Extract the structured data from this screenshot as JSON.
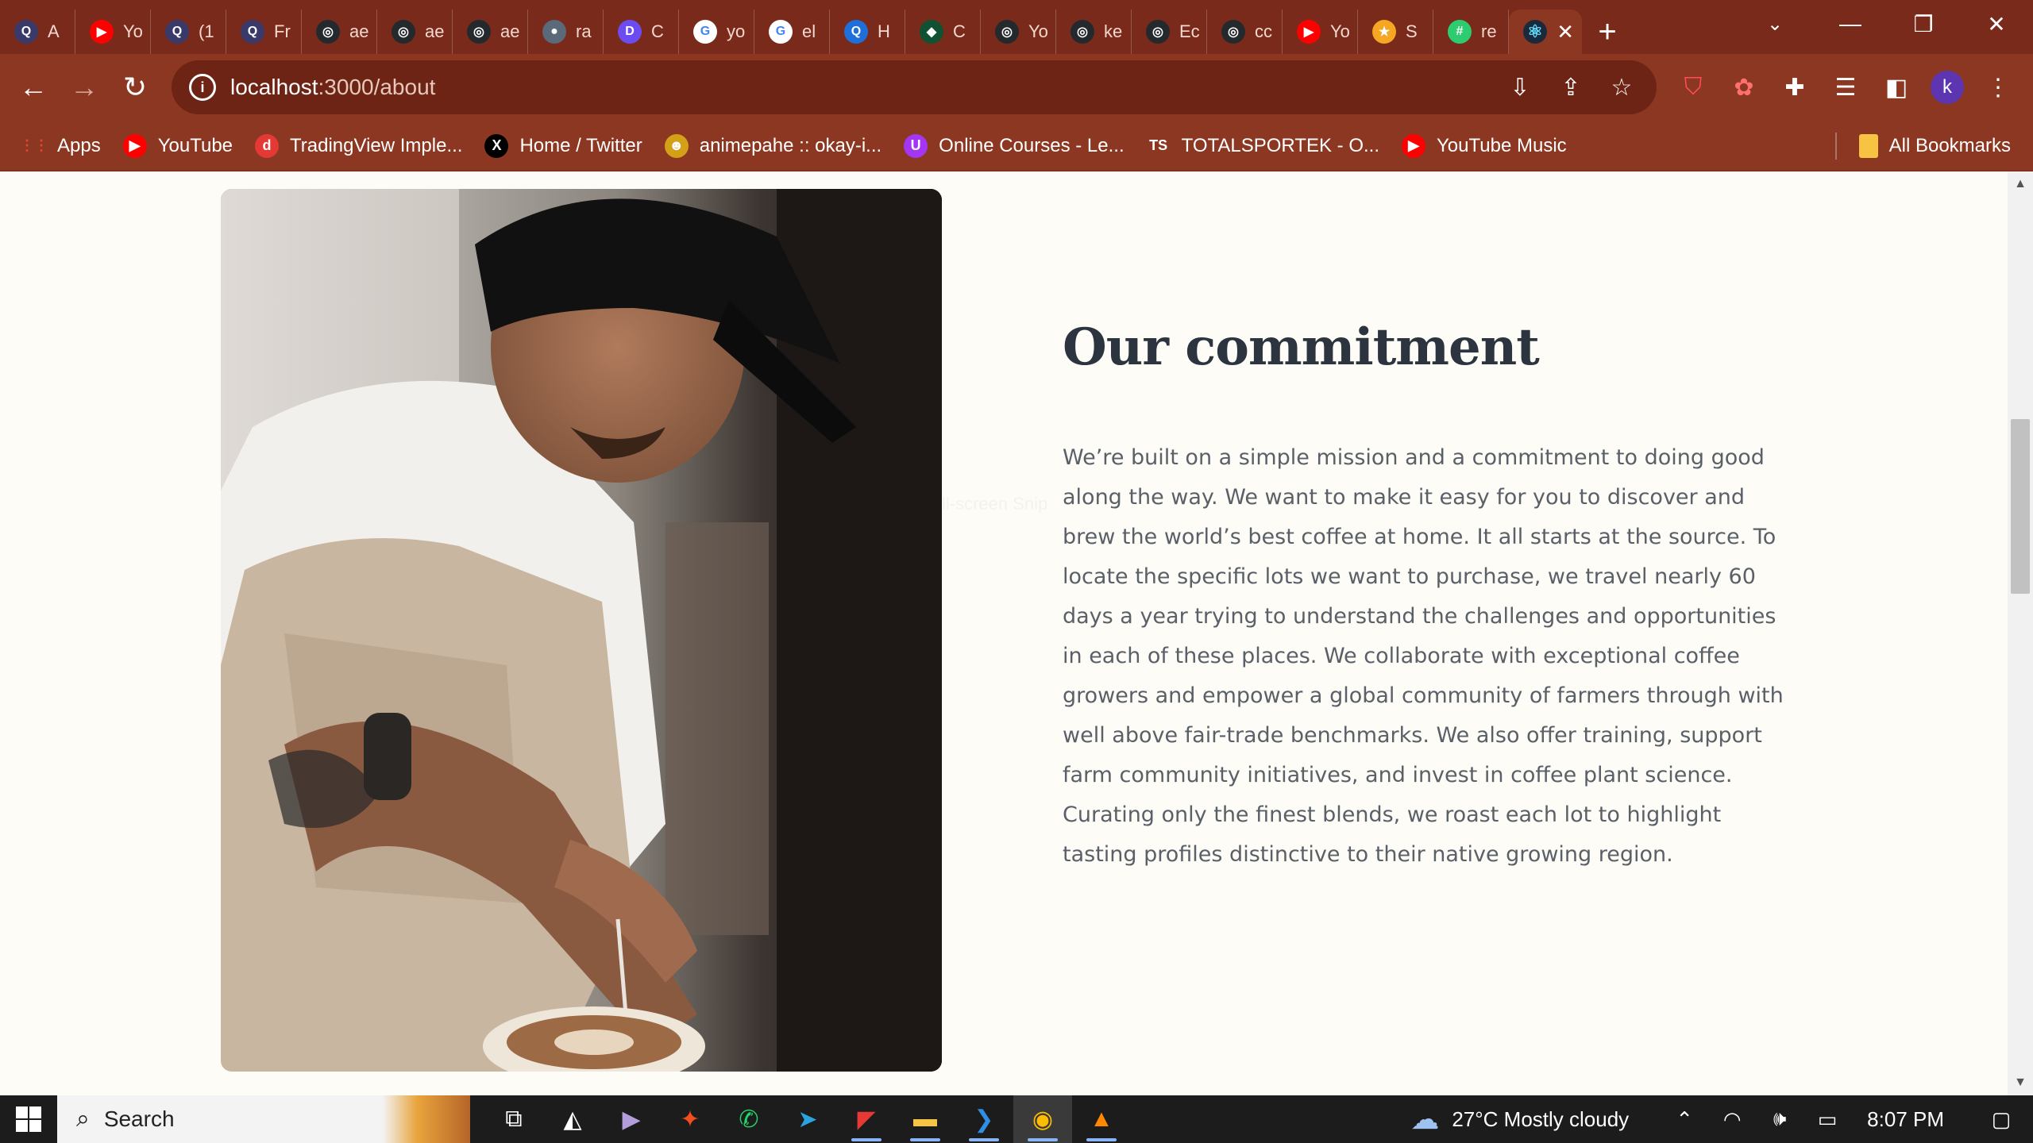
{
  "browser": {
    "tabs": [
      {
        "label": "A",
        "icon": "search-tab-icon",
        "fav_bg": "#3a3a6a",
        "glyph": "Q"
      },
      {
        "label": "Yo",
        "icon": "youtube-icon",
        "fav_bg": "#ff0000",
        "glyph": "▶"
      },
      {
        "label": "(1",
        "icon": "search-tab-icon",
        "fav_bg": "#3a3a6a",
        "glyph": "Q"
      },
      {
        "label": "Fr",
        "icon": "search-tab-icon",
        "fav_bg": "#3a3a6a",
        "glyph": "Q"
      },
      {
        "label": "ae",
        "icon": "github-icon",
        "fav_bg": "#24292e",
        "glyph": "◎"
      },
      {
        "label": "ae",
        "icon": "github-icon",
        "fav_bg": "#24292e",
        "glyph": "◎"
      },
      {
        "label": "ae",
        "icon": "github-icon",
        "fav_bg": "#24292e",
        "glyph": "◎"
      },
      {
        "label": "ra",
        "icon": "globe-icon",
        "fav_bg": "#5a6a7a",
        "glyph": "●"
      },
      {
        "label": "C",
        "icon": "d-app-icon",
        "fav_bg": "#6c4cf1",
        "glyph": "D"
      },
      {
        "label": "yo",
        "icon": "google-icon",
        "fav_bg": "#ffffff",
        "glyph": "G"
      },
      {
        "label": "el",
        "icon": "google-icon",
        "fav_bg": "#ffffff",
        "glyph": "G"
      },
      {
        "label": "H",
        "icon": "h-app-icon",
        "fav_bg": "#1e6fd9",
        "glyph": "Q"
      },
      {
        "label": "C",
        "icon": "leaf-icon",
        "fav_bg": "#0f5132",
        "glyph": "◆"
      },
      {
        "label": "Yo",
        "icon": "github-icon",
        "fav_bg": "#24292e",
        "glyph": "◎"
      },
      {
        "label": "ke",
        "icon": "github-icon",
        "fav_bg": "#24292e",
        "glyph": "◎"
      },
      {
        "label": "Ec",
        "icon": "github-icon",
        "fav_bg": "#24292e",
        "glyph": "◎"
      },
      {
        "label": "cc",
        "icon": "github-icon",
        "fav_bg": "#24292e",
        "glyph": "◎"
      },
      {
        "label": "Yo",
        "icon": "youtube-music-icon",
        "fav_bg": "#ff0000",
        "glyph": "▶"
      },
      {
        "label": "S",
        "icon": "star-icon",
        "fav_bg": "#f5a623",
        "glyph": "★"
      },
      {
        "label": "re",
        "icon": "grid-icon",
        "fav_bg": "#2ecc71",
        "glyph": "#"
      }
    ],
    "active_tab_icon": "react-icon",
    "url_host": "localhost",
    "url_path": ":3000/about",
    "bookmarks": [
      {
        "label": "Apps",
        "icon": "apps-grid-icon",
        "bg": "transparent",
        "glyph": "⋮⋮",
        "color": "#ea4335"
      },
      {
        "label": "YouTube",
        "icon": "youtube-icon",
        "bg": "#ff0000",
        "glyph": "▶",
        "color": "#fff"
      },
      {
        "label": "TradingView Imple...",
        "icon": "d-bookmark-icon",
        "bg": "#e53935",
        "glyph": "d",
        "color": "#fff"
      },
      {
        "label": "Home / Twitter",
        "icon": "x-logo-icon",
        "bg": "#000000",
        "glyph": "X",
        "color": "#fff"
      },
      {
        "label": "animepahe :: okay-i...",
        "icon": "cat-icon",
        "bg": "#d4a017",
        "glyph": "☻",
        "color": "#fff"
      },
      {
        "label": "Online Courses - Le...",
        "icon": "udemy-icon",
        "bg": "#a435f0",
        "glyph": "U",
        "color": "#fff"
      },
      {
        "label": "TOTALSPORTEK - O...",
        "icon": "ts-icon",
        "bg": "transparent",
        "glyph": "TS",
        "color": "#fff"
      },
      {
        "label": "YouTube Music",
        "icon": "youtube-music-icon",
        "bg": "#ff0000",
        "glyph": "▶",
        "color": "#fff"
      }
    ],
    "all_bookmarks_label": "All Bookmarks",
    "profile_initial": "k"
  },
  "page": {
    "heading": "Our commitment",
    "body": "We’re built on a simple mission and a commitment to doing good along the way. We want to make it easy for you to discover and brew the world’s best coffee at home. It all starts at the source. To locate the specific lots we want to purchase, we travel nearly 60 days a year trying to understand the challenges and opportunities in each of these places. We collaborate with exceptional coffee growers and empower a global community of farmers through with well above fair-trade benchmarks. We also offer training, support farm community initiatives, and invest in coffee plant science. Curating only the finest blends, we roast each lot to highlight tasting profiles distinctive to their native growing region.",
    "ghost_text": "ll-screen Snip"
  },
  "taskbar": {
    "search_label": "Search",
    "apps": [
      {
        "name": "task-view-icon",
        "glyph": "⧉",
        "color": "#fff"
      },
      {
        "name": "app-icon-1",
        "glyph": "◭",
        "color": "#fff"
      },
      {
        "name": "media-player-icon",
        "glyph": "▶",
        "color": "#b39ddb"
      },
      {
        "name": "figma-icon",
        "glyph": "✦",
        "color": "#f24e1e"
      },
      {
        "name": "whatsapp-icon",
        "glyph": "✆",
        "color": "#25d366"
      },
      {
        "name": "telegram-icon",
        "glyph": "➤",
        "color": "#2aa3df"
      },
      {
        "name": "app-icon-2",
        "glyph": "◤",
        "color": "#e53935"
      },
      {
        "name": "file-explorer-icon",
        "glyph": "▬",
        "color": "#f6c342"
      },
      {
        "name": "vscode-icon",
        "glyph": "❯",
        "color": "#2f8ee6"
      },
      {
        "name": "chrome-icon",
        "glyph": "◉",
        "color": "#fbbc05"
      },
      {
        "name": "vlc-icon",
        "glyph": "▲",
        "color": "#ff8800"
      }
    ],
    "weather": "27°C  Mostly cloudy",
    "time": "8:07 PM"
  }
}
